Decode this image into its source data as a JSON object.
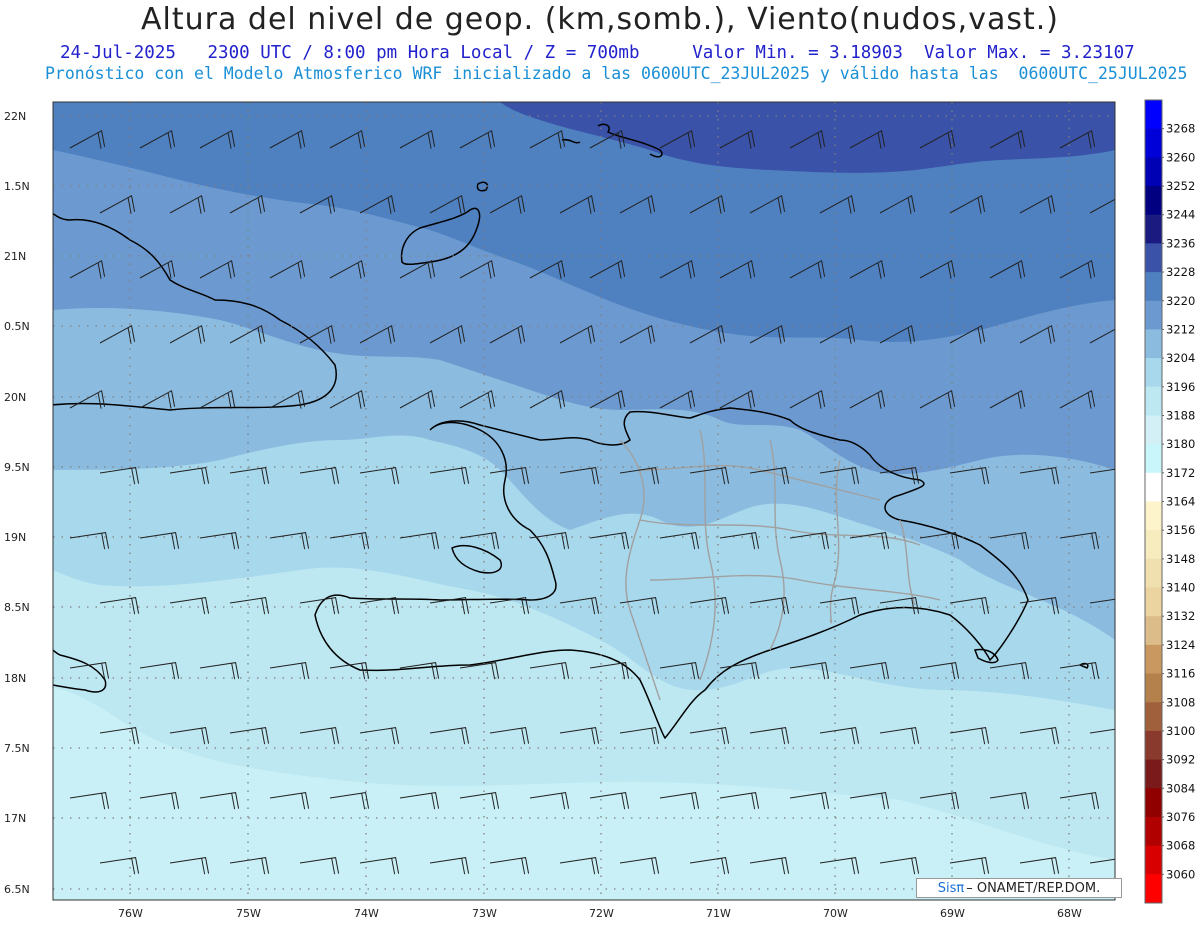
{
  "header": {
    "title": "Altura del nivel de geop. (km,somb.), Viento(nudos,vast.)",
    "date": "24-Jul-2025",
    "time": "2300 UTC / 8:00 pm Hora Local / Z = 700mb",
    "min_label": "Valor Min. = 3.18903",
    "max_label": "Valor Max. = 3.23107",
    "model_line": "Pronóstico con el Modelo Atmosferico WRF inicializado a las 0600UTC_23JUL2025 y válido hasta las  0600UTC_25JUL2025"
  },
  "axes": {
    "lat_labels": [
      "22N",
      "1.5N",
      "21N",
      "0.5N",
      "20N",
      "9.5N",
      "19N",
      "8.5N",
      "18N",
      "7.5N",
      "17N",
      "6.5N"
    ],
    "lon_labels": [
      "76W",
      "75W",
      "74W",
      "73W",
      "72W",
      "71W",
      "70W",
      "69W",
      "68W"
    ]
  },
  "colorbar": {
    "levels": [
      "3268",
      "3260",
      "3252",
      "3244",
      "3236",
      "3228",
      "3220",
      "3212",
      "3204",
      "3196",
      "3188",
      "3180",
      "3172",
      "3164",
      "3156",
      "3148",
      "3140",
      "3132",
      "3124",
      "3116",
      "3108",
      "3100",
      "3092",
      "3084",
      "3076",
      "3068",
      "3060"
    ],
    "colors": [
      "#0000ff",
      "#0000d8",
      "#0000b4",
      "#000080",
      "#1a1a80",
      "#3a52a8",
      "#4f80c0",
      "#6c9ad0",
      "#8bbce0",
      "#a8d8ec",
      "#bde8f2",
      "#d2f0f6",
      "#c8f6fa",
      "#ffffff",
      "#fdf4cc",
      "#f6ecbe",
      "#f0e0b0",
      "#ecd4a0",
      "#dcbc88",
      "#c89860",
      "#b4804c",
      "#a0603c",
      "#8a3a2c",
      "#7a1a1a",
      "#900000",
      "#b00000",
      "#d80000",
      "#ff0000"
    ]
  },
  "field": {
    "shades": {
      "darkest": "#3a52a8",
      "dark": "#4f80c0",
      "mid": "#6c9ad0",
      "light": "#8bbce0",
      "lighter": "#a8d8ec",
      "lightest": "#bde8f2",
      "pale": "#c8f0f6"
    }
  },
  "credit": {
    "brand": "Sisπ",
    "text": "– ONAMET/REP.DOM."
  }
}
